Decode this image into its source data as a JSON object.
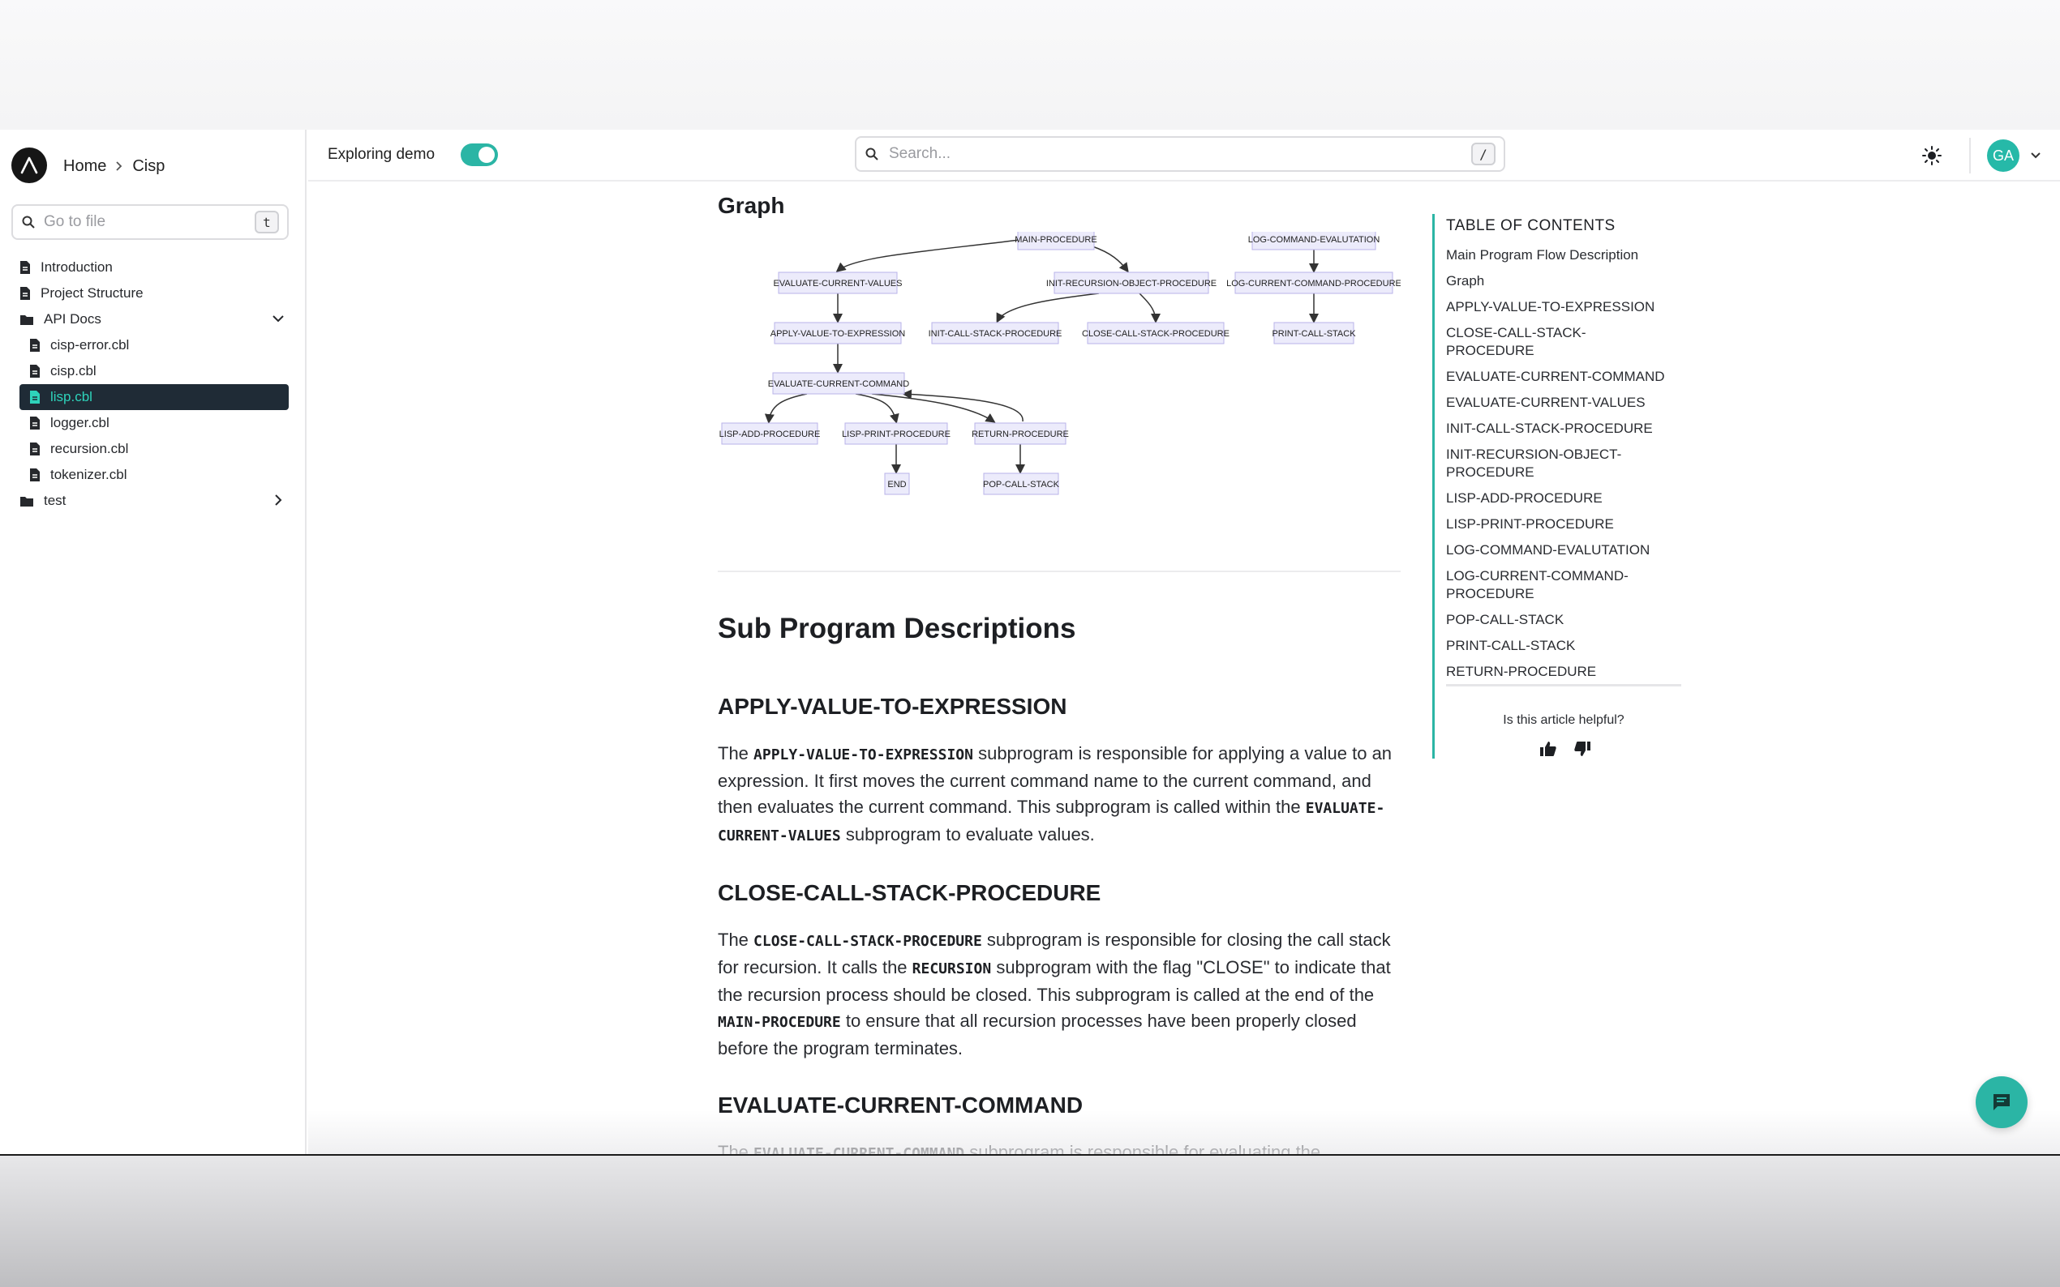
{
  "breadcrumb": {
    "home": "Home",
    "current": "Cisp"
  },
  "goto": {
    "placeholder": "Go to file",
    "shortcut": "t"
  },
  "sidebar": {
    "items": [
      {
        "label": "Introduction",
        "type": "doc"
      },
      {
        "label": "Project Structure",
        "type": "doc"
      },
      {
        "label": "API Docs",
        "type": "folder"
      },
      {
        "label": "cisp-error.cbl",
        "type": "doc"
      },
      {
        "label": "cisp.cbl",
        "type": "doc"
      },
      {
        "label": "lisp.cbl",
        "type": "doc"
      },
      {
        "label": "logger.cbl",
        "type": "doc"
      },
      {
        "label": "recursion.cbl",
        "type": "doc"
      },
      {
        "label": "tokenizer.cbl",
        "type": "doc"
      },
      {
        "label": "test",
        "type": "folder"
      }
    ]
  },
  "header": {
    "demo_label": "Exploring demo",
    "search_placeholder": "Search...",
    "search_shortcut": "/",
    "avatar_initials": "GA"
  },
  "content": {
    "graph_heading": "Graph",
    "graph_nodes": [
      "MAIN-PROCEDURE",
      "LOG-COMMAND-EVALUTATION",
      "EVALUATE-CURRENT-VALUES",
      "INIT-RECURSION-OBJECT-PROCEDURE",
      "LOG-CURRENT-COMMAND-PROCEDURE",
      "APPLY-VALUE-TO-EXPRESSION",
      "INIT-CALL-STACK-PROCEDURE",
      "CLOSE-CALL-STACK-PROCEDURE",
      "PRINT-CALL-STACK",
      "EVALUATE-CURRENT-COMMAND",
      "LISP-ADD-PROCEDURE",
      "LISP-PRINT-PROCEDURE",
      "RETURN-PROCEDURE",
      "END",
      "POP-CALL-STACK"
    ],
    "section_title": "Sub Program Descriptions",
    "sections": [
      {
        "title": "APPLY-VALUE-TO-EXPRESSION",
        "p": {
          "t1": "The ",
          "c1": "APPLY-VALUE-TO-EXPRESSION",
          "t2": " subprogram is responsible for applying a value to an expression. It first moves the current command name to the current command, and then evaluates the current command. This subprogram is called within the ",
          "c2": "EVALUATE-CURRENT-VALUES",
          "t3": " subprogram to evaluate values."
        }
      },
      {
        "title": "CLOSE-CALL-STACK-PROCEDURE",
        "p": {
          "t1": "The ",
          "c1": "CLOSE-CALL-STACK-PROCEDURE",
          "t2": " subprogram is responsible for closing the call stack for recursion. It calls the ",
          "c2": "RECURSION",
          "t3": " subprogram with the flag \"CLOSE\" to indicate that the recursion process should be closed. This subprogram is called at the end of the ",
          "c3": "MAIN-PROCEDURE",
          "t4": " to ensure that all recursion processes have been properly closed before the program terminates."
        }
      },
      {
        "title": "EVALUATE-CURRENT-COMMAND",
        "p": {
          "t1": "The ",
          "c1": "EVALUATE-CURRENT-COMMAND",
          "t2": " subprogram is responsible for evaluating the"
        }
      }
    ]
  },
  "toc": {
    "title": "TABLE OF CONTENTS",
    "items": [
      "Main Program Flow Description",
      "Graph",
      "APPLY-VALUE-TO-EXPRESSION",
      "CLOSE-CALL-STACK-PROCEDURE",
      "EVALUATE-CURRENT-COMMAND",
      "EVALUATE-CURRENT-VALUES",
      "INIT-CALL-STACK-PROCEDURE",
      "INIT-RECURSION-OBJECT-PROCEDURE",
      "LISP-ADD-PROCEDURE",
      "LISP-PRINT-PROCEDURE",
      "LOG-COMMAND-EVALUTATION",
      "LOG-CURRENT-COMMAND-PROCEDURE",
      "POP-CALL-STACK",
      "PRINT-CALL-STACK",
      "RETURN-PROCEDURE"
    ],
    "helpful": "Is this article helpful?"
  },
  "colors": {
    "accent": "#2bb5a5",
    "active_bg": "#1f2b36",
    "active_text": "#2ed3bb",
    "node_fill": "#ecebfb",
    "node_stroke": "#b9b3e8"
  }
}
